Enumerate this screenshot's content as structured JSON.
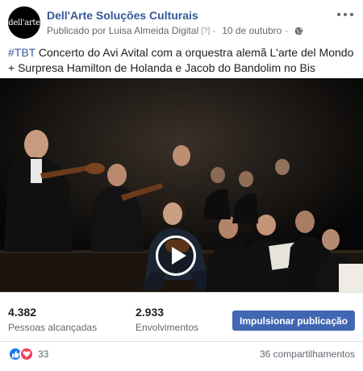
{
  "post": {
    "page_name": "Dell'Arte Soluções Culturais",
    "avatar_text": "dell'arte",
    "published_by": "Publicado por Luisa Almeida Digital",
    "help_marker": "[?]",
    "separator": "·",
    "date": "10 de outubro",
    "privacy_icon": "globe-icon",
    "more_icon": "more-options-icon"
  },
  "caption": {
    "hashtag": "#TBT",
    "text": " Concerto do Avi Avital com a orquestra alemã L'arte del Mondo + Surpresa Hamilton de Holanda e Jacob do Bandolim no Bis"
  },
  "video": {
    "play_icon": "play-icon",
    "stage_color": "#0b0b0b"
  },
  "stats": {
    "reach_value": "4.382",
    "reach_label": "Pessoas alcançadas",
    "engagement_value": "2.933",
    "engagement_label": "Envolvimentos",
    "boost_label": "Impulsionar publicação",
    "boost_color": "#4267b2"
  },
  "footer": {
    "reaction_icons": [
      "like-icon",
      "love-icon"
    ],
    "reaction_count": "33",
    "shares": "36 compartilhamentos"
  }
}
